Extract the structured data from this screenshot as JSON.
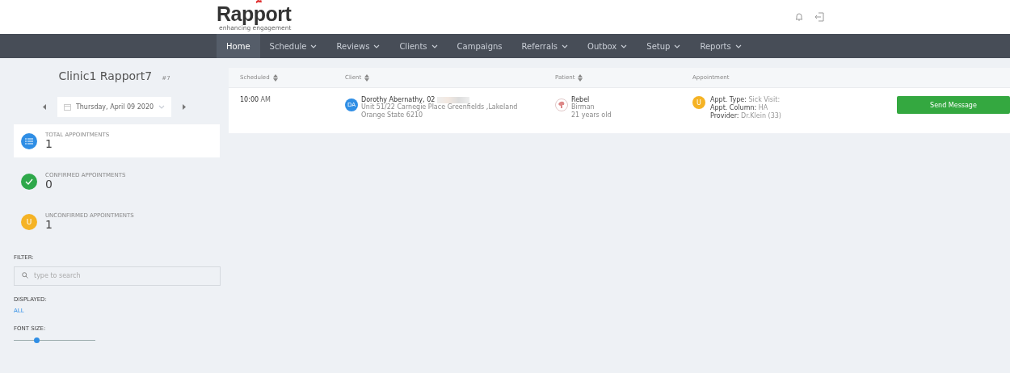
{
  "logo": {
    "name": "Rapport",
    "tagline": "enhancing engagement"
  },
  "nav": [
    {
      "label": "Home",
      "selected": true,
      "dropdown": false
    },
    {
      "label": "Schedule",
      "selected": false,
      "dropdown": true
    },
    {
      "label": "Reviews",
      "selected": false,
      "dropdown": true
    },
    {
      "label": "Clients",
      "selected": false,
      "dropdown": true
    },
    {
      "label": "Campaigns",
      "selected": false,
      "dropdown": false
    },
    {
      "label": "Referrals",
      "selected": false,
      "dropdown": true
    },
    {
      "label": "Outbox",
      "selected": false,
      "dropdown": true
    },
    {
      "label": "Setup",
      "selected": false,
      "dropdown": true
    },
    {
      "label": "Reports",
      "selected": false,
      "dropdown": true
    }
  ],
  "sidebar": {
    "clinic": "Clinic1 Rapport7",
    "clinic_number": "#7",
    "date": "Thursday, April 09 2020",
    "stats": [
      {
        "kind": "list",
        "label": "TOTAL APPOINTMENTS",
        "count": "1",
        "selected": true,
        "color": "#2f8ee5"
      },
      {
        "kind": "check",
        "label": "CONFIRMED APPOINTMENTS",
        "count": "0",
        "selected": false,
        "color": "#2ea84a"
      },
      {
        "kind": "letter",
        "letter": "U",
        "label": "UNCONFIRMED APPOINTMENTS",
        "count": "1",
        "selected": false,
        "color": "#f5b325"
      }
    ],
    "filter_label": "FILTER:",
    "filter_placeholder": "type to search",
    "displayed_label": "DISPLAYED:",
    "displayed_value": "ALL",
    "font_size_label": "FONT SIZE:",
    "font_size": {
      "level": 0.28
    }
  },
  "table": {
    "columns": [
      {
        "label": "Scheduled",
        "sortable": true
      },
      {
        "label": "Client",
        "sortable": true
      },
      {
        "label": "Patient",
        "sortable": true
      },
      {
        "label": "Appointment",
        "sortable": false
      }
    ],
    "rows": [
      {
        "time": "10:00",
        "ampm": "AM",
        "client_initials": "DA",
        "client_name": "Dorothy Abernathy, 02",
        "client_address": "Unit 51/22 Carnegie Place Greenfields ,Lakeland",
        "client_city": "Orange State 6210",
        "patient_name": "Rebel",
        "patient_breed": "Birman",
        "patient_age": "21 years old",
        "status_letter": "U",
        "appt_type_label": "Appt. Type:",
        "appt_type": "Sick Visit:",
        "appt_column_label": "Appt. Column:",
        "appt_column": "HA",
        "provider_label": "Provider:",
        "provider": "Dr.Klein (33)",
        "action": "Send Message"
      }
    ]
  }
}
